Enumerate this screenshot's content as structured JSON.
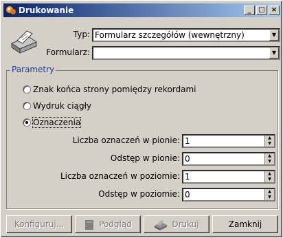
{
  "window": {
    "title": "Drukowanie"
  },
  "form": {
    "type_label": "Typ:",
    "type_value": "Formularz szczegółów (wewnętrzny)",
    "form_label": "Formularz:",
    "form_value": ""
  },
  "group": {
    "title": "Parametry",
    "options": [
      {
        "label": "Znak końca strony pomiędzy rekordami",
        "selected": false
      },
      {
        "label": "Wydruk ciągły",
        "selected": false
      },
      {
        "label": "Oznaczenia",
        "selected": true
      }
    ],
    "fields": [
      {
        "label": "Liczba oznaczeń w pionie:",
        "value": "1"
      },
      {
        "label": "Odstęp w pionie:",
        "value": "0"
      },
      {
        "label": "Liczba oznaczeń w poziomie:",
        "value": "1"
      },
      {
        "label": "Odstęp w poziomie:",
        "value": "0"
      }
    ]
  },
  "buttons": {
    "configure": "Konfiguruj...",
    "preview": "Podgląd",
    "print": "Drukuj",
    "close": "Zamknij"
  },
  "icons": [
    "app-icon",
    "printer-icon",
    "minimize-icon",
    "maximize-icon",
    "close-icon",
    "preview-icon",
    "print-icon"
  ]
}
